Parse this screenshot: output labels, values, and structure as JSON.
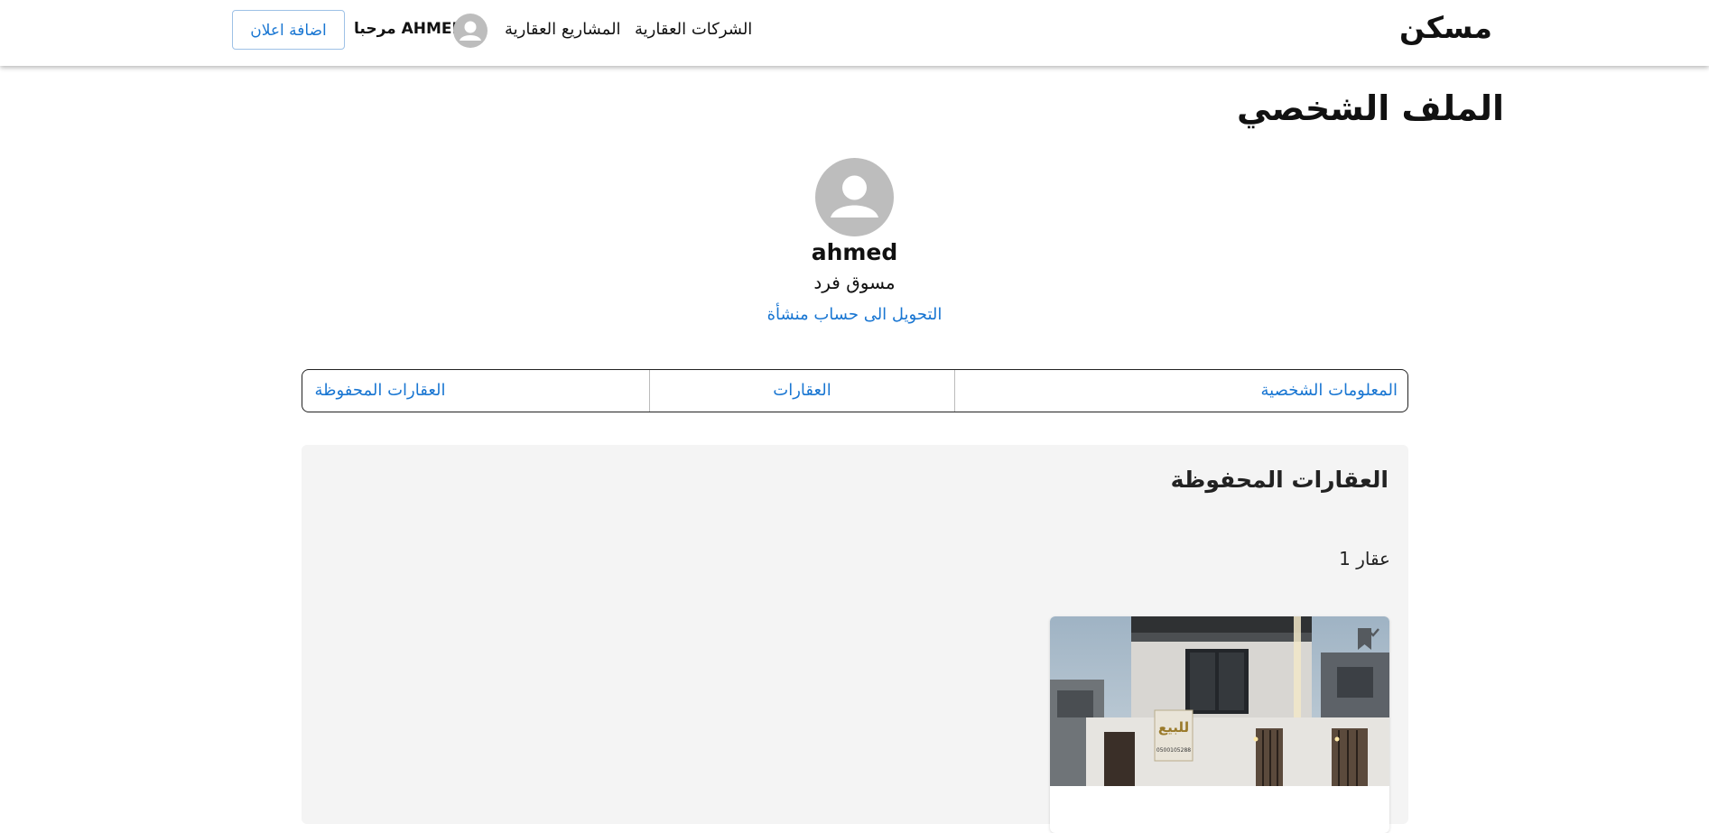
{
  "header": {
    "brand": "مسكن",
    "nav": {
      "companies": "الشركات العقارية",
      "projects": "المشاريع العقارية"
    },
    "user_greeting": "مرحبا AHMED",
    "add_ad_label": "اضافة اعلان"
  },
  "profile": {
    "page_title": "الملف الشخصي",
    "name": "ahmed",
    "role": "مسوق فرد",
    "switch_account_link": "التحويل الى حساب منشأة"
  },
  "tabs": {
    "personal_info": "المعلومات الشخصية",
    "properties": "العقارات",
    "saved_properties": "العقارات المحفوظة"
  },
  "saved": {
    "title": "العقارات المحفوظة",
    "count_text": "1 عقار",
    "cards": [
      {
        "image_sign_text": "للبيع",
        "image_sign_phone": "0500105288",
        "bookmarked": true
      }
    ]
  },
  "colors": {
    "link_blue": "#1976d2",
    "panel_bg": "#f4f4f4",
    "avatar_gray": "#bdbdbd"
  }
}
